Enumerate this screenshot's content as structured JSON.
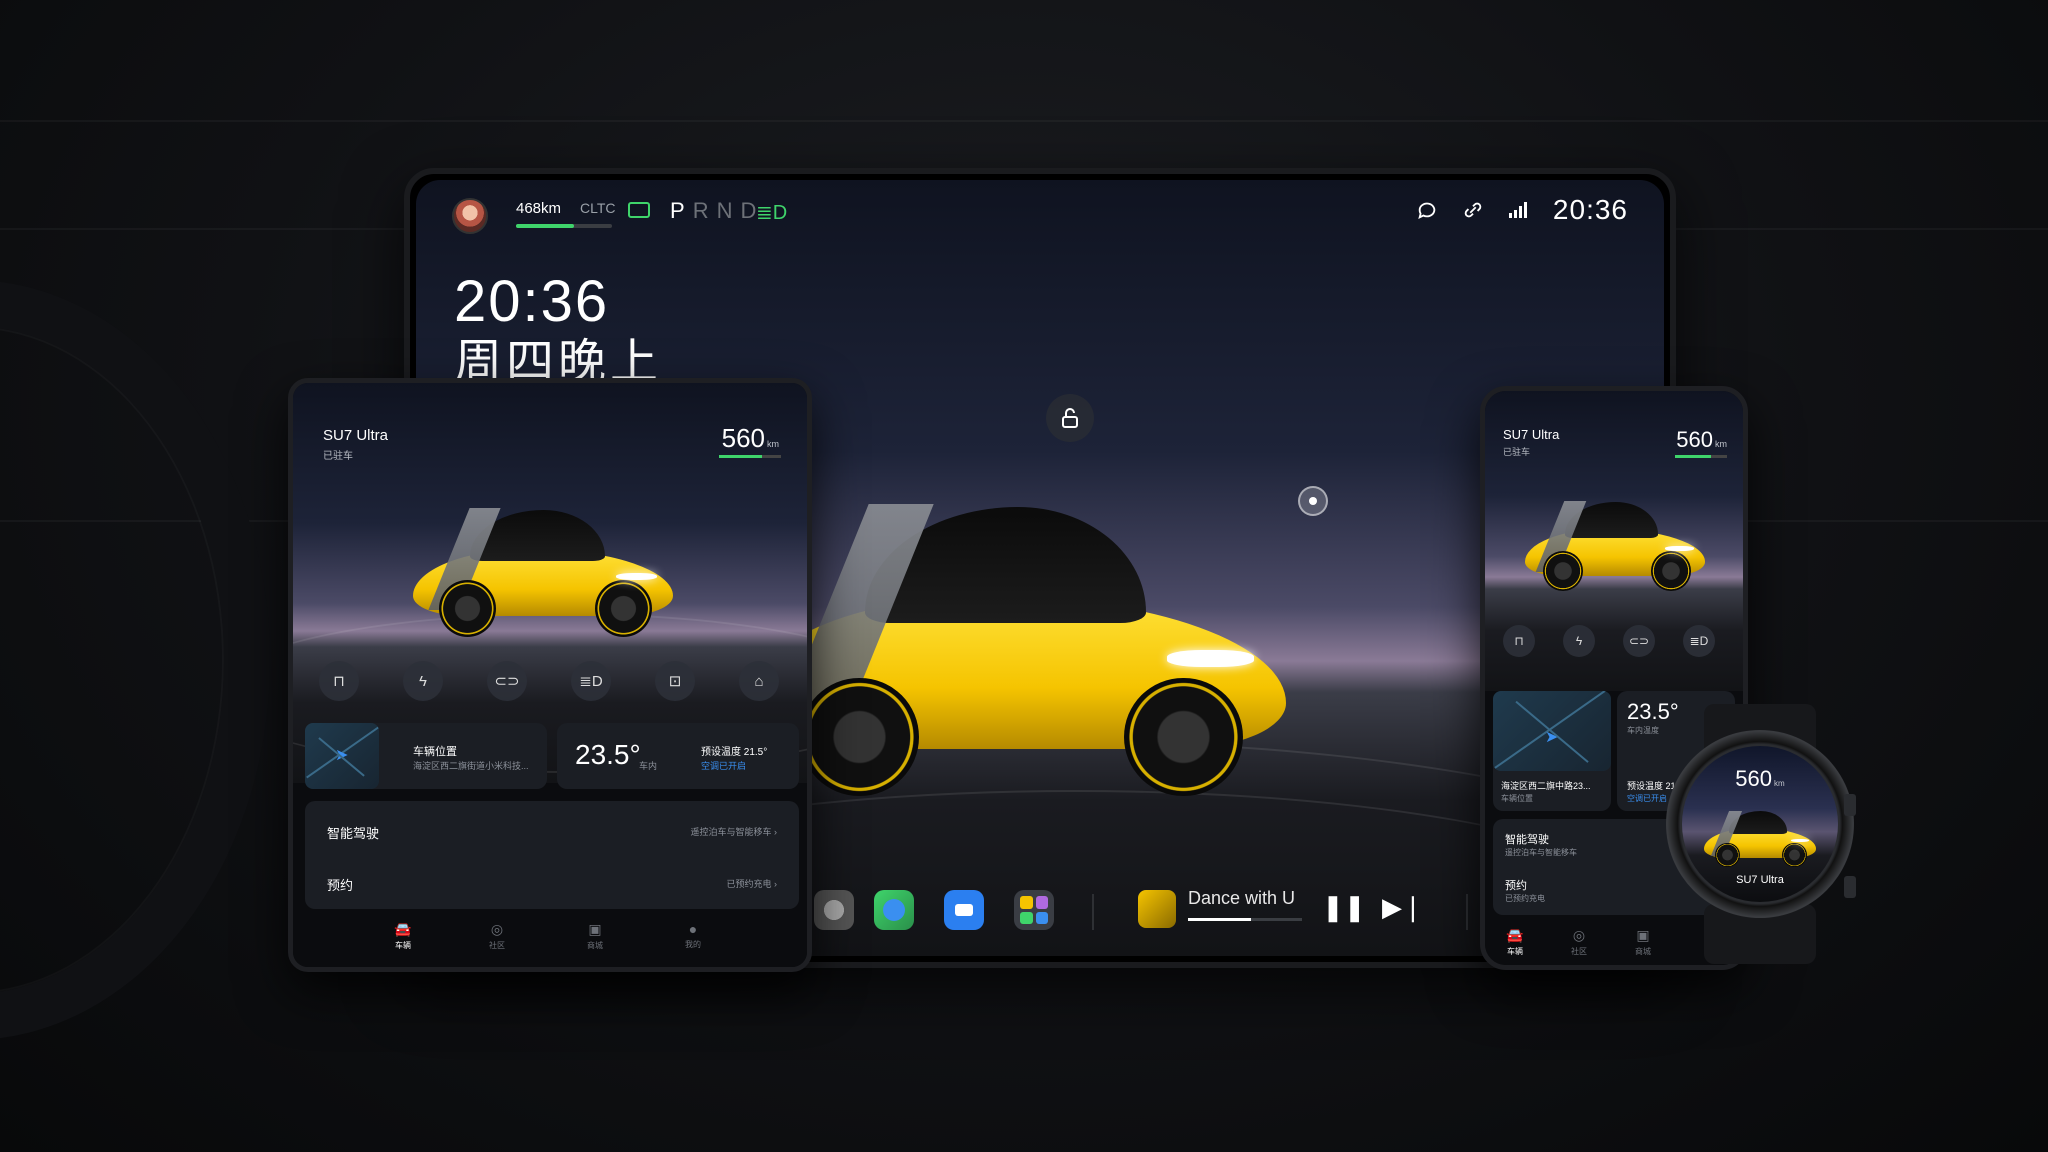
{
  "main": {
    "status": {
      "range": "468km",
      "cycle": "CLTC",
      "gear_selected": "P",
      "gear_others": "RND",
      "clock": "20:36"
    },
    "big_time": "20:36",
    "day_label": "周四晚上",
    "dock": {
      "track_title": "Dance with U"
    }
  },
  "tablet": {
    "model": "SU7 Ultra",
    "parked": "已驻车",
    "range": "560",
    "range_unit": "km",
    "location_title": "车辆位置",
    "location_addr": "海淀区西二旗街道小米科技...",
    "temp": "23.5°",
    "temp_label": "车内",
    "preset": "预设温度 21.5°",
    "ac_on": "空调已开启",
    "smart_drive": "智能驾驶",
    "smart_drive_desc": "遥控泊车与智能移车",
    "booking": "预约",
    "booking_desc": "已预约充电",
    "nav": [
      "车辆",
      "社区",
      "商城",
      "我的"
    ]
  },
  "phone": {
    "model": "SU7 Ultra",
    "parked": "已驻车",
    "range": "560",
    "range_unit": "km",
    "location_addr": "海淀区西二旗中路23...",
    "location_title": "车辆位置",
    "temp": "23.5°",
    "temp_label": "车内温度",
    "preset": "预设温度 21",
    "ac_on": "空调已开启",
    "smart_drive": "智能驾驶",
    "smart_drive_desc": "遥控泊车与智能移车",
    "booking": "预约",
    "booking_desc": "已预约充电",
    "nav": [
      "车辆",
      "社区",
      "商城"
    ]
  },
  "watch": {
    "range": "560",
    "range_unit": "km",
    "model": "SU7 Ultra"
  },
  "colors": {
    "accent_green": "#3fd46b",
    "accent_blue": "#3a8ff0",
    "car_yellow": "#f5c400"
  }
}
